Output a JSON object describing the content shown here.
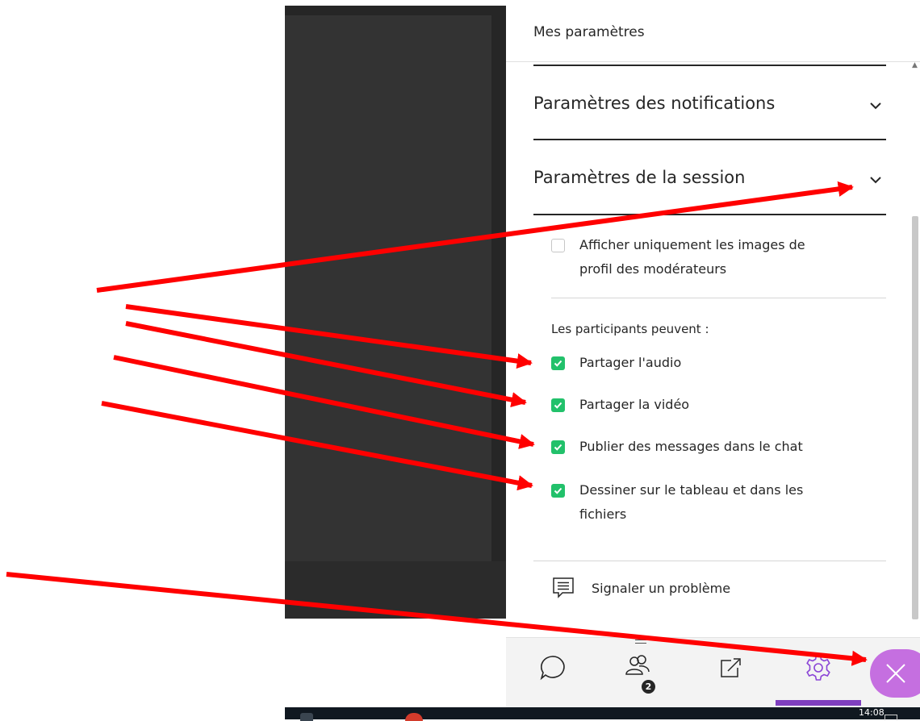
{
  "panel": {
    "title": "Mes paramètres",
    "sections": {
      "notifications": "Paramètres des notifications",
      "session": "Paramètres de la session"
    },
    "moderator_option": {
      "label_line1": "Afficher uniquement les images de",
      "label_line2": "profil des modérateurs",
      "checked": false
    },
    "participants_label": "Les participants peuvent :",
    "permissions": [
      {
        "label": "Partager l'audio",
        "checked": true
      },
      {
        "label": "Partager la vidéo",
        "checked": true
      },
      {
        "label": "Publier des messages dans le chat",
        "checked": true
      },
      {
        "label_line1": "Dessiner sur le tableau et dans les",
        "label_line2": "fichiers",
        "checked": true
      }
    ],
    "report_problem": "Signaler un problème"
  },
  "tabbar": {
    "participants_badge": "2",
    "active_tab": "settings-tab",
    "icons": [
      "chat-icon",
      "participants-icon",
      "share-content-icon",
      "gear-icon",
      "close-icon"
    ]
  },
  "taskbar": {
    "time": "14:08"
  },
  "colors": {
    "checkbox_on": "#22c16b",
    "accent_purple": "#7f3fbf",
    "close_button": "#c56fe0",
    "annotation_arrow": "#ff0000",
    "stage_dark": "#333333"
  }
}
